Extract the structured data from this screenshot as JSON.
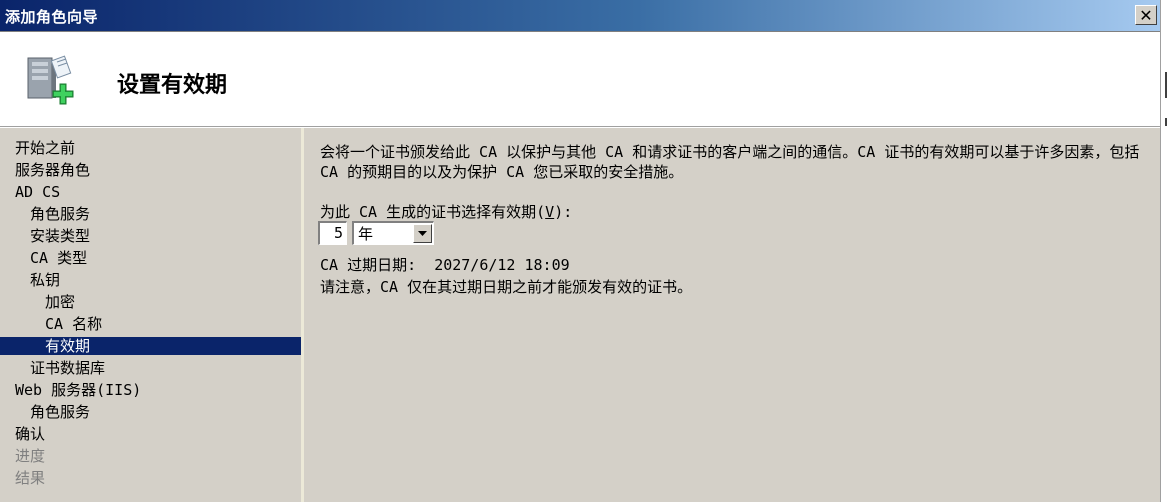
{
  "window": {
    "title": "添加角色向导",
    "close_label": "✕"
  },
  "header": {
    "title": "设置有效期",
    "icon": "server-add-icon"
  },
  "nav": {
    "items": [
      {
        "label": "开始之前",
        "indent": 0,
        "state": "normal"
      },
      {
        "label": "服务器角色",
        "indent": 0,
        "state": "normal"
      },
      {
        "label": "AD CS",
        "indent": 0,
        "state": "normal"
      },
      {
        "label": "角色服务",
        "indent": 1,
        "state": "normal"
      },
      {
        "label": "安装类型",
        "indent": 1,
        "state": "normal"
      },
      {
        "label": "CA 类型",
        "indent": 1,
        "state": "normal"
      },
      {
        "label": "私钥",
        "indent": 1,
        "state": "normal"
      },
      {
        "label": "加密",
        "indent": 2,
        "state": "normal"
      },
      {
        "label": "CA 名称",
        "indent": 2,
        "state": "normal"
      },
      {
        "label": "有效期",
        "indent": 2,
        "state": "selected"
      },
      {
        "label": "证书数据库",
        "indent": 1,
        "state": "normal"
      },
      {
        "label": "Web 服务器(IIS)",
        "indent": 0,
        "state": "normal"
      },
      {
        "label": "角色服务",
        "indent": 1,
        "state": "normal"
      },
      {
        "label": "确认",
        "indent": 0,
        "state": "normal"
      },
      {
        "label": "进度",
        "indent": 0,
        "state": "disabled"
      },
      {
        "label": "结果",
        "indent": 0,
        "state": "disabled"
      }
    ]
  },
  "content": {
    "description": "会将一个证书颁发给此 CA 以保护与其他 CA 和请求证书的客户端之间的通信。CA 证书的有效期可以基于许多因素，包括 CA 的预期目的以及为保护 CA 您已采取的安全措施。",
    "period_label_prefix": "为此 CA 生成的证书选择有效期(",
    "period_label_accel": "V",
    "period_label_suffix": "):",
    "period_value": "5",
    "period_unit": "年",
    "expiration_label": "CA 过期日期:",
    "expiration_value": "2027/6/12 18:09",
    "note": "请注意，CA 仅在其过期日期之前才能颁发有效的证书。"
  },
  "colors": {
    "selection": "#0a246a",
    "panel": "#d4d0c8",
    "disabled_text": "#808080"
  }
}
